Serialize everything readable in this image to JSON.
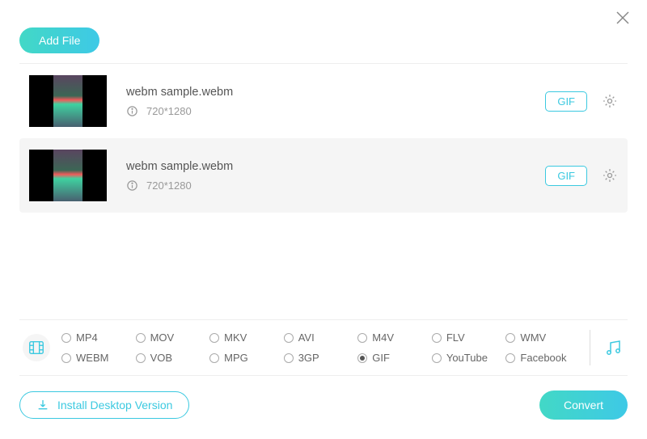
{
  "buttons": {
    "add_file": "Add File",
    "install": "Install Desktop Version",
    "convert": "Convert"
  },
  "items": [
    {
      "name": "webm sample.webm",
      "resolution": "720*1280",
      "format": "GIF",
      "selected": false
    },
    {
      "name": "webm sample.webm",
      "resolution": "720*1280",
      "format": "GIF",
      "selected": true
    }
  ],
  "formats": {
    "row1": [
      "MP4",
      "MOV",
      "MKV",
      "AVI",
      "M4V",
      "FLV",
      "WMV"
    ],
    "row2": [
      "WEBM",
      "VOB",
      "MPG",
      "3GP",
      "GIF",
      "YouTube",
      "Facebook"
    ],
    "selected": "GIF"
  }
}
